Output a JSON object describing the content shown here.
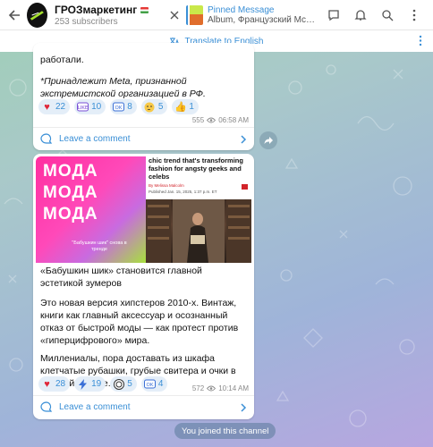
{
  "header": {
    "channel_title": "ГРОЗмаркетинг",
    "subscribers": "253 subscribers",
    "pinned_label": "Pinned Message",
    "pinned_text": "Album, Французский McDona..."
  },
  "translate": {
    "label": "Translate to English"
  },
  "messages": [
    {
      "text_top": "работали.",
      "footnote": "*Принадлежит Meta, признанной экстремистской организацией в РФ.",
      "reactions": [
        {
          "emoji": "heart",
          "count": "22"
        },
        {
          "emoji": "like-badge",
          "count": "10"
        },
        {
          "emoji": "ok-badge",
          "count": "8"
        },
        {
          "emoji": "thinking",
          "count": "5"
        },
        {
          "emoji": "thumbs-up",
          "count": "1"
        }
      ],
      "views": "555",
      "time": "06:58 AM",
      "comment_label": "Leave a comment"
    },
    {
      "image": {
        "moda_words": [
          "МОДА",
          "МОДА",
          "МОДА"
        ],
        "caption": "\"Бабушкин шик\" снова в тренде",
        "article_title": "chic trend that's transforming fashion for angsty geeks and celebs",
        "byline": "By Melissa Malcolm",
        "date": "Published Jan. 15, 2025, 1:37 p.m. ET"
      },
      "title": "«Бабушкин шик» становится главной эстетикой зумеров",
      "paragraph1": "Это новая версия хипстеров 2010-х. Винтаж, книги как главный аксессуар и осознанный отказ от быстрой моды — как протест против «гиперцифрового» мира.",
      "paragraph2": "Миллениалы, пора доставать из шкафа клетчатые рубашки, грубые свитера и очки в роговой оправе.",
      "reactions": [
        {
          "emoji": "heart",
          "count": "28"
        },
        {
          "emoji": "lightning",
          "count": "19"
        },
        {
          "emoji": "seal-badge",
          "count": "5"
        },
        {
          "emoji": "ok-badge",
          "count": "4"
        }
      ],
      "views": "572",
      "time": "10:14 AM",
      "comment_label": "Leave a comment"
    }
  ],
  "service": {
    "joined": "You joined this channel"
  },
  "colors": {
    "accent": "#3a8fd6",
    "heart": "#e0283a"
  }
}
